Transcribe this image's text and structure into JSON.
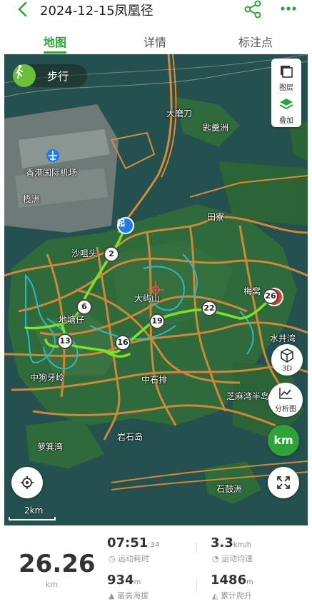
{
  "header": {
    "title": "2024-12-15凤凰径"
  },
  "tabs": [
    {
      "label": "地图",
      "active": true
    },
    {
      "label": "详情",
      "active": false
    },
    {
      "label": "标注点",
      "active": false
    }
  ],
  "map": {
    "mode_label": "步行",
    "layer_label": "图层",
    "overlay_label": "叠加",
    "btn_3d_label": "3D",
    "btn_analysis_label": "分析图",
    "btn_km_label": "km",
    "scale_label": "2km",
    "start_marker": "起",
    "places": [
      "大磨刀",
      "匙羹洲",
      "香港国际机场",
      "榄洲",
      "田寮",
      "沙咀头",
      "大屿山",
      "梅窝",
      "地塘仔",
      "水井湾",
      "中狗牙岭",
      "中石排",
      "芝麻湾半岛",
      "萝箕湾",
      "岩石岛",
      "石鼓洲"
    ],
    "waypoints": [
      "2",
      "6",
      "13",
      "16",
      "19",
      "22",
      "26"
    ],
    "colors": {
      "track": "#7de02a",
      "road": "#d8893a",
      "water_line": "#2fb6c9",
      "accent": "#2fa33a"
    }
  },
  "stats": {
    "distance_value": "26.26",
    "distance_unit": "km",
    "duration_value": "07:51",
    "duration_seconds": ":34",
    "duration_label": "运动耗时",
    "speed_value": "3.3",
    "speed_unit": "km/h",
    "speed_label": "运动均速",
    "max_alt_value": "934",
    "max_alt_unit": "m",
    "max_alt_label": "最高海拔",
    "climb_value": "1486",
    "climb_unit": "m",
    "climb_label": "累计爬升"
  }
}
